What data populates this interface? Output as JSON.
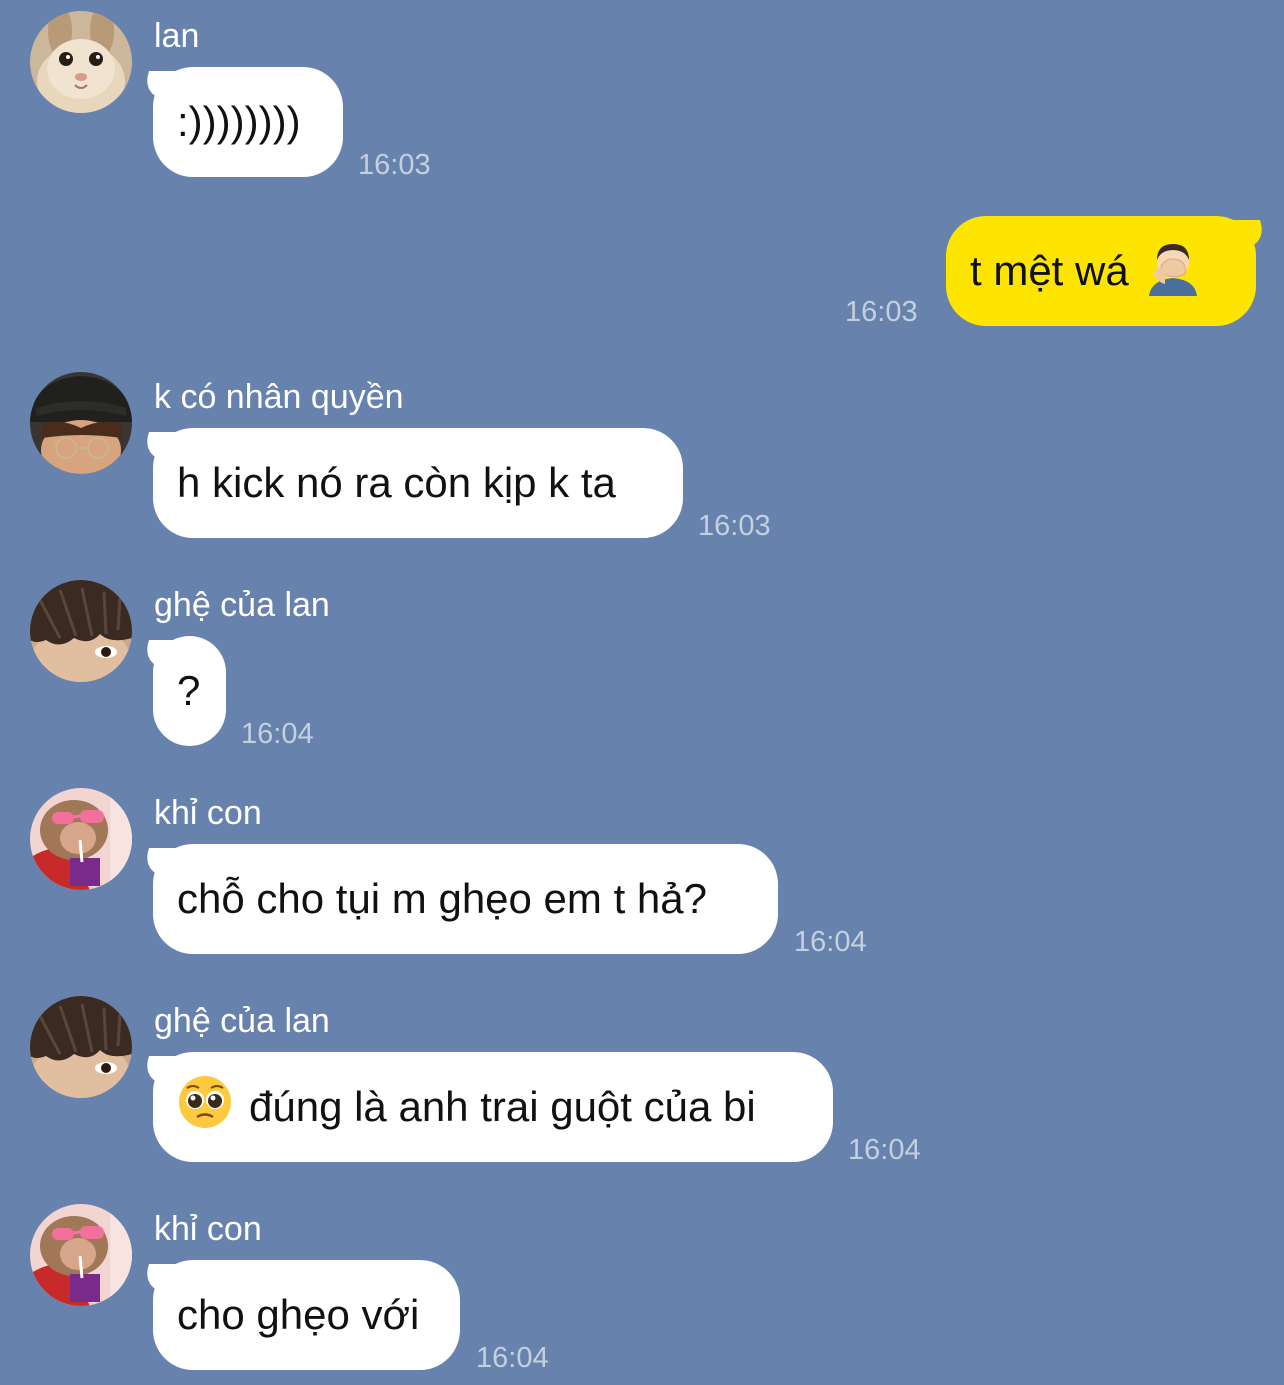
{
  "messages": [
    {
      "sender": "lan",
      "avatar": "rabbit-avatar",
      "text": ":))))))))",
      "time": "16:03",
      "direction": "incoming"
    },
    {
      "sender": "",
      "avatar": "",
      "text": "t mệt wá",
      "emoji": "man-facepalming-emoji",
      "time": "16:03",
      "direction": "outgoing"
    },
    {
      "sender": "k có nhân quyền",
      "avatar": "boy-hat-avatar",
      "text": "h kick nó ra còn kịp k ta",
      "time": "16:03",
      "direction": "incoming"
    },
    {
      "sender": "ghệ của lan",
      "avatar": "hair-eye-avatar",
      "text": "?",
      "time": "16:04",
      "direction": "incoming"
    },
    {
      "sender": "khỉ con",
      "avatar": "monkey-sunglasses-avatar",
      "text": "chỗ cho tụi m ghẹo em t hả?",
      "time": "16:04",
      "direction": "incoming"
    },
    {
      "sender": "ghệ của lan",
      "avatar": "hair-eye-avatar",
      "text": "đúng là anh trai guột của bi",
      "emoji": "pleading-face-emoji",
      "time": "16:04",
      "direction": "incoming"
    },
    {
      "sender": "khỉ con",
      "avatar": "monkey-sunglasses-avatar",
      "text": "cho ghẹo với",
      "time": "16:04",
      "direction": "incoming"
    }
  ],
  "colors": {
    "background": "#6783ad",
    "incoming_bubble": "#ffffff",
    "outgoing_bubble": "#fee500",
    "sender_name": "#ffffff",
    "timestamp": "#c4cfe0"
  }
}
